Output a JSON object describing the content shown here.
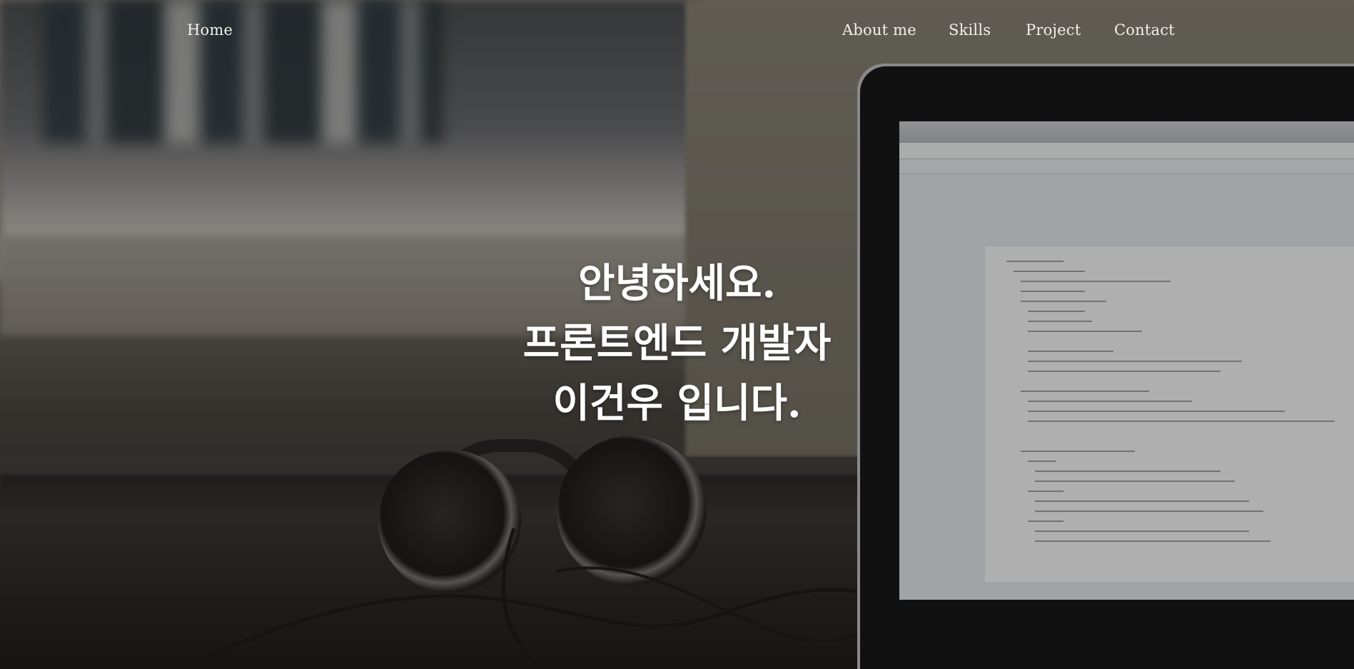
{
  "nav": {
    "home": "Home",
    "about": "About me",
    "skills": "Skills",
    "project": "Project",
    "contact": "Contact"
  },
  "hero": {
    "line1": "안녕하세요.",
    "line2": "프론트엔드 개발자",
    "line3": "이건우 입니다."
  },
  "colors": {
    "nav_text": "#f1efe9",
    "headline_text": "#ffffff"
  }
}
